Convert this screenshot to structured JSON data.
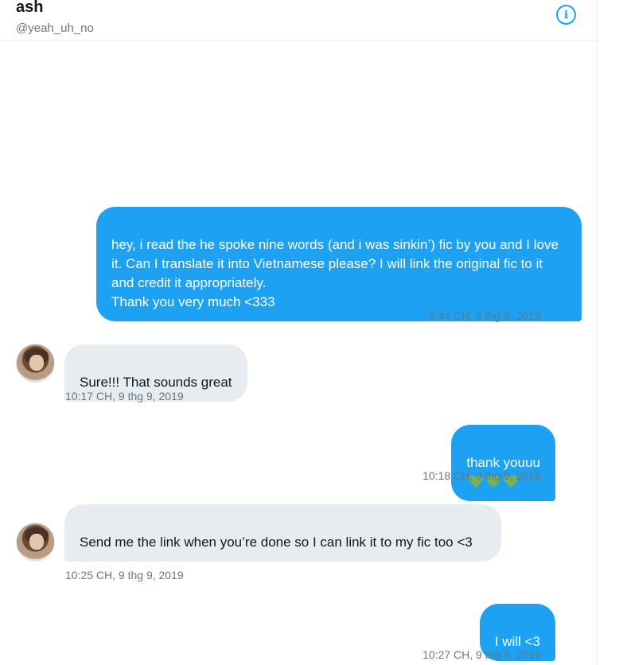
{
  "header": {
    "name": "ash",
    "handle": "@yeah_uh_no",
    "info_icon": "info-icon"
  },
  "messages": [
    {
      "direction": "sent",
      "text": "hey, i read the he spoke nine words (and i was sinkin’) fic by you and I love it. Can I translate it into Vietnamese please? I will link the original fic to it and credit it appropriately.\nThank you very much <333",
      "timestamp": "9:44 CH, 9 thg 9, 2019"
    },
    {
      "direction": "received",
      "text": "Sure!!! That sounds great",
      "timestamp": "10:17 CH, 9 thg 9, 2019"
    },
    {
      "direction": "sent",
      "text": "thank youuu",
      "emoji": "green-heart-icon ×3",
      "timestamp": "10:18 CH, 9 thg 9, 2019"
    },
    {
      "direction": "received",
      "text": "Send me the link when you’re done so I can link it to my fic too <3",
      "timestamp": "10:25 CH, 9 thg 9, 2019"
    },
    {
      "direction": "sent",
      "text": "I will <3",
      "timestamp": "10:27 CH, 9 thg 9, 2019"
    }
  ],
  "colors": {
    "sent_bubble": "#1da1f2",
    "received_bubble": "#e6ecf0",
    "heart": "#77b255",
    "meta_text": "#657786"
  }
}
